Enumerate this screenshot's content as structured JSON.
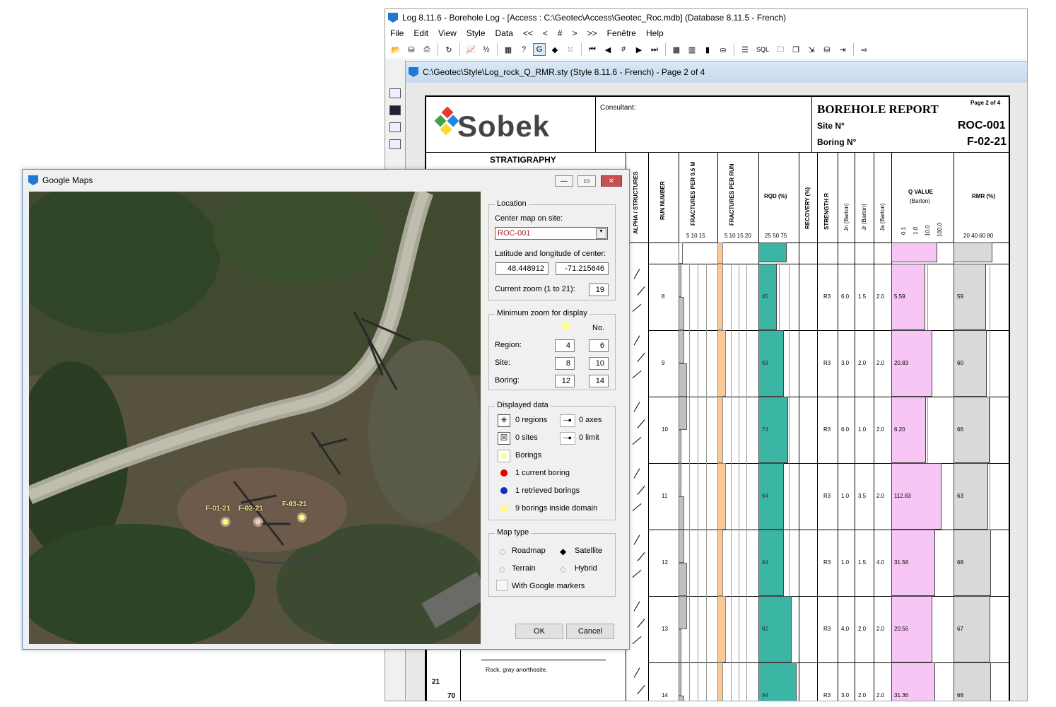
{
  "log_window": {
    "title": "Log 8.11.6 - Borehole Log - [Access : C:\\Geotec\\Access\\Geotec_Roc.mdb] (Database 8.11.5 - French)",
    "menu": [
      "File",
      "Edit",
      "View",
      "Style",
      "Data",
      "<<",
      "<",
      "#",
      ">",
      ">>",
      "Fenêtre",
      "Help"
    ],
    "toolbar_sql": "SQL"
  },
  "style_window": {
    "title": "C:\\Geotec\\Style\\Log_rock_Q_RMR.sty (Style 8.11.6 - French) - Page 2 of 4"
  },
  "report": {
    "logo_text": "Sobek",
    "consultant_label": "Consultant:",
    "title": "BOREHOLE REPORT",
    "page_label": "Page 2 of 4",
    "site_label": "Site N°",
    "site_value": "ROC-001",
    "boring_label": "Boring N°",
    "boring_value": "F-02-21",
    "stratigraphy": "STRATIGRAPHY",
    "columns": {
      "alpha": "ALPHA / STRUCTURES",
      "run": "RUN NUMBER",
      "frac05": "FRACTURES PER 0.5 M",
      "frac05_ticks": "5  10 15",
      "fracrun": "FRACTURES PER RUN",
      "fracrun_ticks": "5  10 15 20",
      "rqd": "RQD (%)",
      "rqd_ticks": "25  50  75",
      "recovery": "RECOVERY (%)",
      "strength": "STRENGTH R",
      "jn": "Jn (Barton)",
      "jr": "Jr (Barton)",
      "ja": "Ja (Barton)",
      "q": "Q VALUE",
      "q_sub": "(Barton)",
      "q_ticks": [
        "0.1",
        "1.0",
        "10.0",
        "100.0"
      ],
      "rmr": "RMR (%)",
      "rmr_ticks": "20  40  60  80"
    },
    "description": "Rock, gray anorthosite.",
    "depth_21": "21",
    "depth_70": "70",
    "rows": [
      {
        "run": "8",
        "rqd": "45",
        "rqd_v": 45,
        "r": "R3",
        "jn": "6.0",
        "jr": "1.5",
        "ja": "2.0",
        "q": "5.59",
        "q_v": 5.59,
        "rmr": "59",
        "rmr_v": 59
      },
      {
        "run": "9",
        "rqd": "63",
        "rqd_v": 63,
        "r": "R3",
        "jn": "3.0",
        "jr": "2.0",
        "ja": "2.0",
        "q": "20.83",
        "q_v": 20.83,
        "rmr": "60",
        "rmr_v": 60
      },
      {
        "run": "10",
        "rqd": "74",
        "rqd_v": 74,
        "r": "R3",
        "jn": "6.0",
        "jr": "1.0",
        "ja": "2.0",
        "q": "6.20",
        "q_v": 6.2,
        "rmr": "66",
        "rmr_v": 66
      },
      {
        "run": "11",
        "rqd": "64",
        "rqd_v": 64,
        "r": "R3",
        "jn": "1.0",
        "jr": "3.5",
        "ja": "2.0",
        "q": "112.83",
        "q_v": 112.83,
        "rmr": "63",
        "rmr_v": 63
      },
      {
        "run": "12",
        "rqd": "64",
        "rqd_v": 64,
        "r": "R3",
        "jn": "1.0",
        "jr": "1.5",
        "ja": "4.0",
        "q": "31.58",
        "q_v": 31.58,
        "rmr": "68",
        "rmr_v": 68
      },
      {
        "run": "13",
        "rqd": "82",
        "rqd_v": 82,
        "r": "R3",
        "jn": "4.0",
        "jr": "2.0",
        "ja": "2.0",
        "q": "20.56",
        "q_v": 20.56,
        "rmr": "67",
        "rmr_v": 67
      },
      {
        "run": "14",
        "rqd": "94",
        "rqd_v": 94,
        "r": "R3",
        "jn": "3.0",
        "jr": "2.0",
        "ja": "2.0",
        "q": "31.36",
        "q_v": 31.36,
        "rmr": "68",
        "rmr_v": 68
      }
    ]
  },
  "google_maps": {
    "title": "Google Maps",
    "markers": [
      {
        "label": "F-01-21",
        "color": "#fdfd7a"
      },
      {
        "label": "F-02-21",
        "color": "#f7c3c3"
      },
      {
        "label": "F-03-21",
        "color": "#fdfd7a"
      }
    ],
    "location": {
      "legend": "Location",
      "center_label": "Center map on site:",
      "site": "ROC-001",
      "latlon_label": "Latitude and longitude of center:",
      "lat": "48.448912",
      "lon": "-71.215646",
      "zoom_label": "Current zoom (1 to 21):",
      "zoom": "19"
    },
    "min_zoom": {
      "legend": "Minimum zoom for display",
      "no_label": "No.",
      "region_label": "Region:",
      "region_a": "4",
      "region_b": "6",
      "site_label": "Site:",
      "site_a": "8",
      "site_b": "10",
      "boring_label": "Boring:",
      "boring_a": "12",
      "boring_b": "14"
    },
    "displayed": {
      "legend": "Displayed data",
      "regions": "0 regions",
      "axes": "0 axes",
      "sites": "0 sites",
      "limit": "0 limit",
      "borings": "Borings",
      "current": "1 current boring",
      "retrieved": "1 retrieved borings",
      "inside": "9 borings inside domain"
    },
    "map_type": {
      "legend": "Map type",
      "roadmap": "Roadmap",
      "satellite": "Satellite",
      "terrain": "Terrain",
      "hybrid": "Hybrid",
      "google_markers": "With Google markers",
      "selected": "Satellite"
    },
    "ok": "OK",
    "cancel": "Cancel"
  },
  "colors": {
    "rqd": "#3bb5a4",
    "frac": "#f9c896",
    "q": "#f8c6f5",
    "rmr": "#d9d9d9",
    "frac05": "#c0c0c0",
    "current_boring": "#e00000",
    "retrieved_boring": "#1030c0",
    "inside_boring": "#fdfd7a"
  }
}
